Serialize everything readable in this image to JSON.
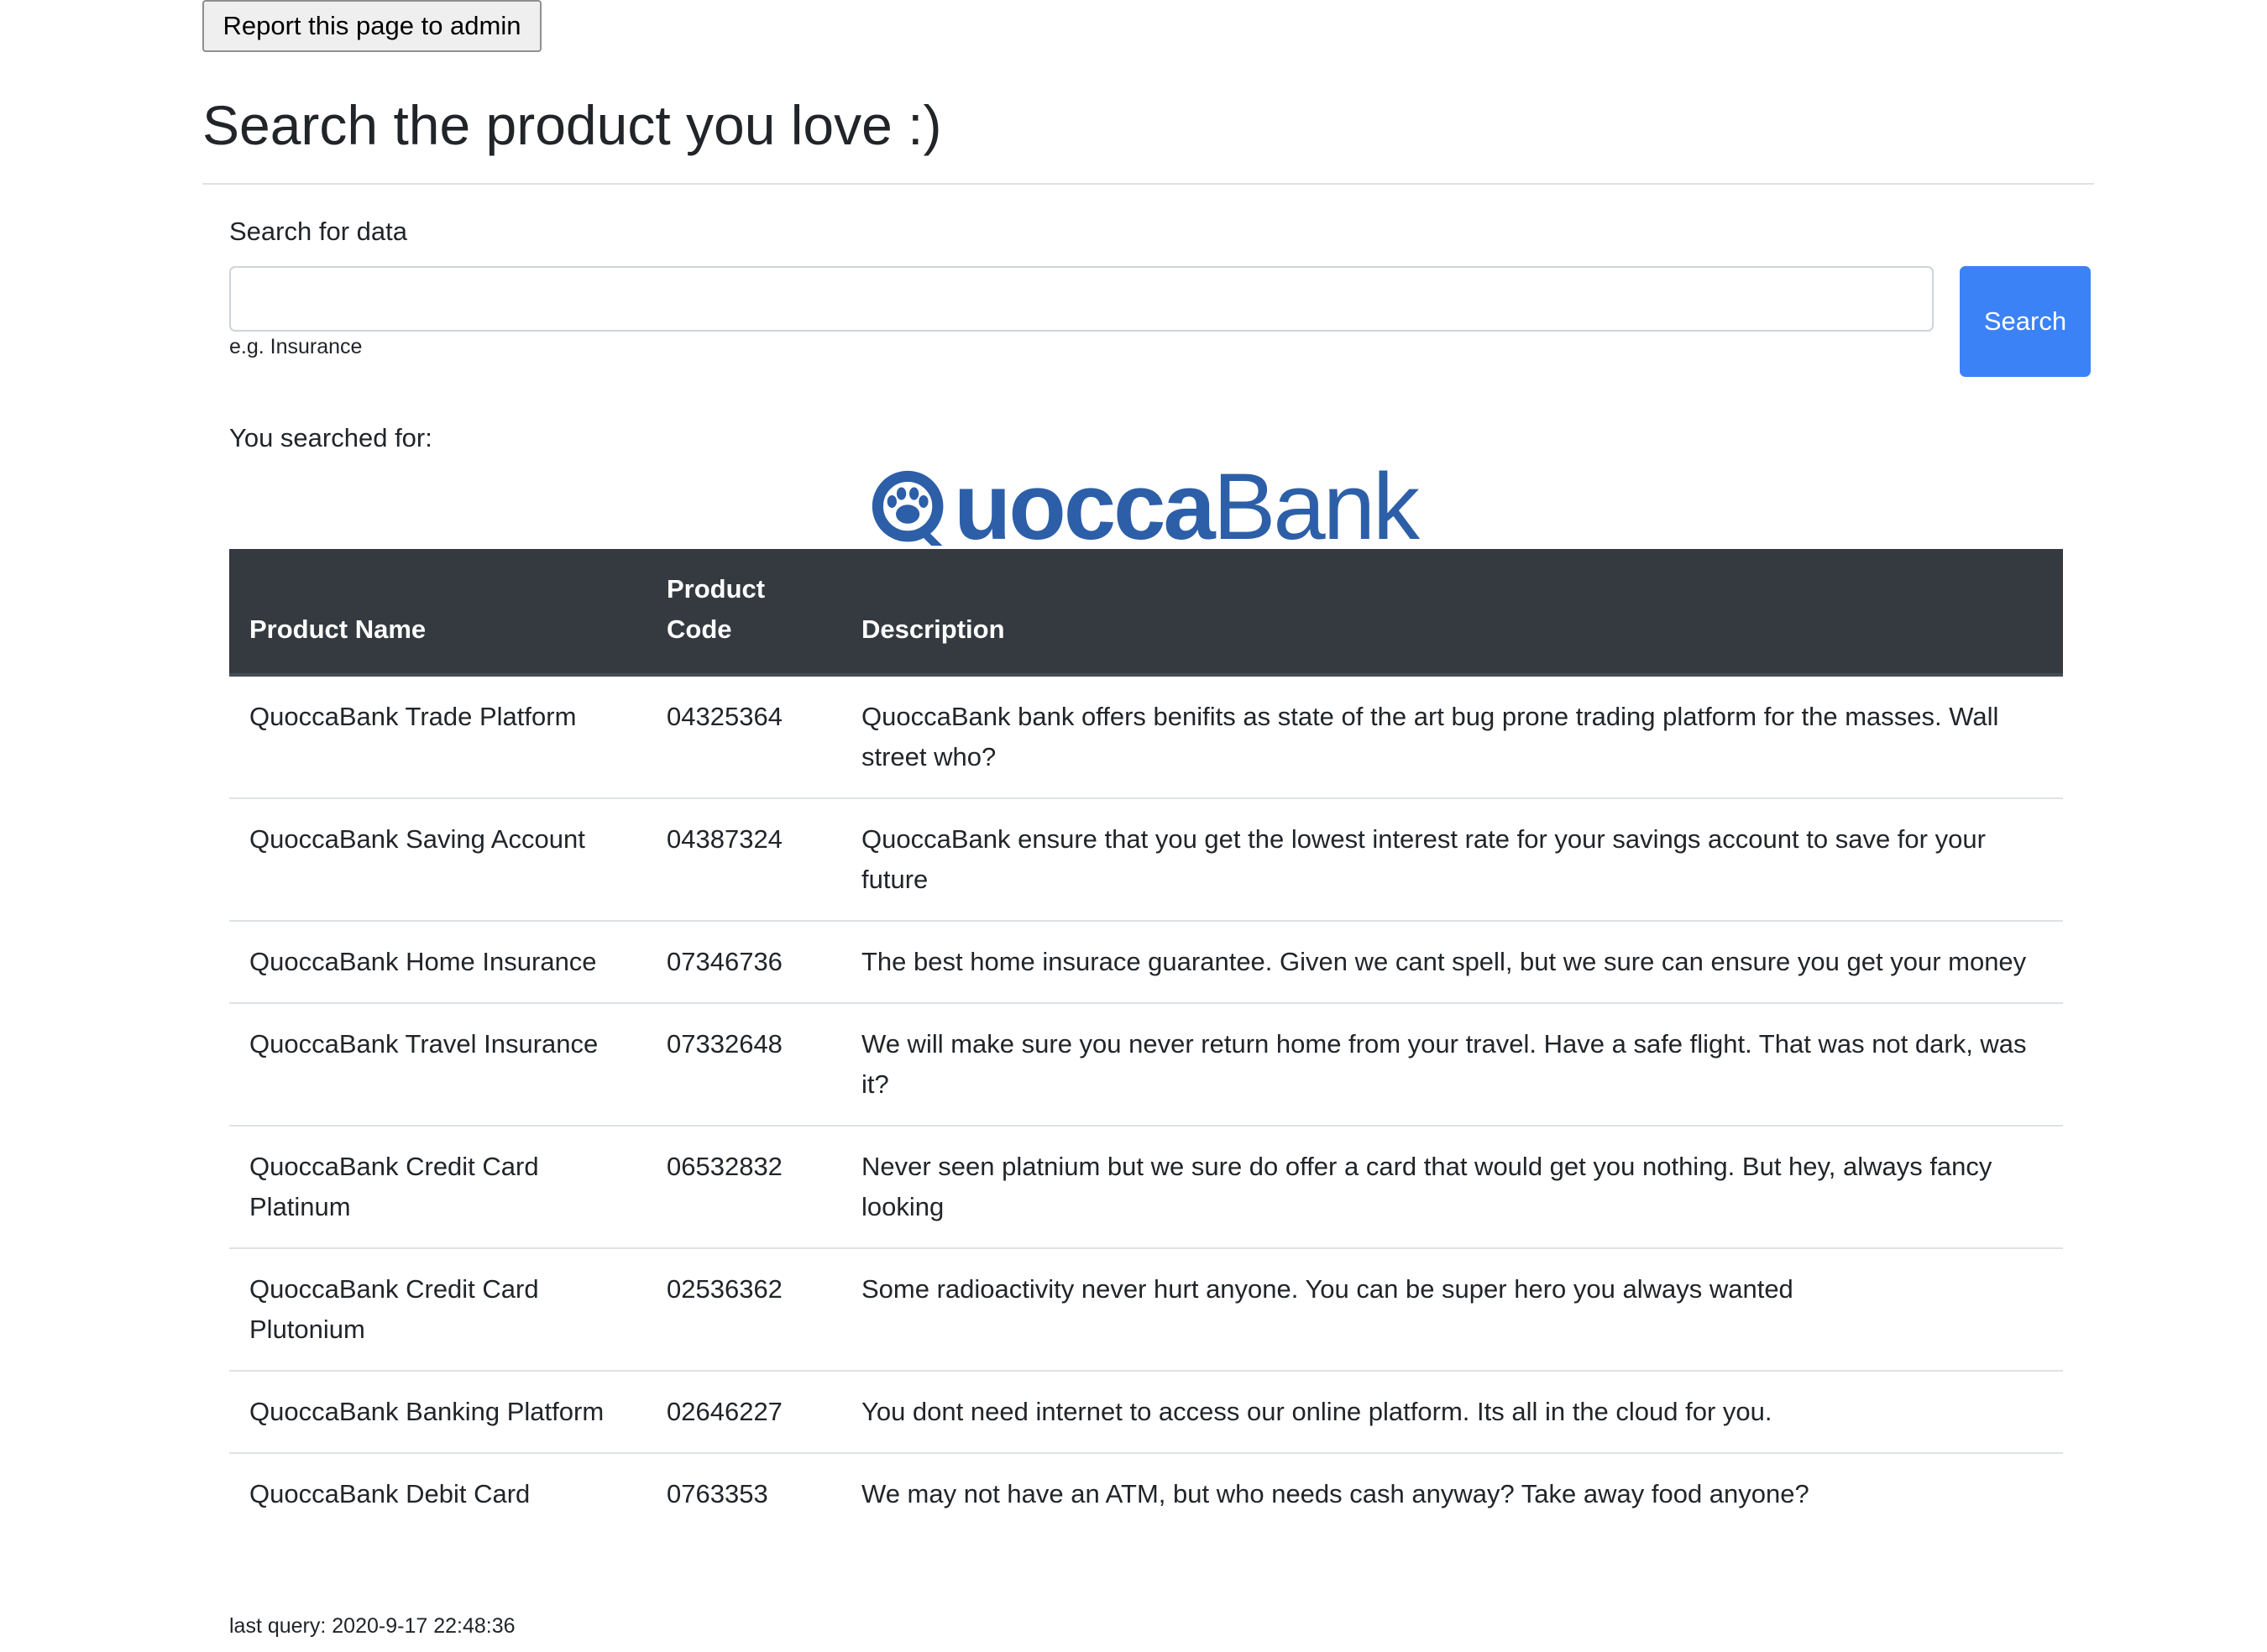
{
  "report_button": {
    "label": "Report this page to admin"
  },
  "heading": "Search the product you love :)",
  "search": {
    "label": "Search for data",
    "value": "",
    "placeholder": "",
    "help_text": "e.g. Insurance",
    "button_label": "Search"
  },
  "searched_for": "You searched for:",
  "logo": {
    "text_bold": "uocca",
    "text_light": "Bank",
    "full_text": "QuoccaBank",
    "icon": "paw-icon",
    "color": "#2d5fa8"
  },
  "table": {
    "headers": {
      "name": "Product Name",
      "code_line1": "Product",
      "code_line2": "Code",
      "description": "Description"
    },
    "rows": [
      {
        "name": "QuoccaBank Trade Platform",
        "code": "04325364",
        "description": "QuoccaBank bank offers benifits as state of the art bug prone trading platform for the masses. Wall street who?"
      },
      {
        "name": "QuoccaBank Saving Account",
        "code": "04387324",
        "description": "QuoccaBank ensure that you get the lowest interest rate for your savings account to save for your future"
      },
      {
        "name": "QuoccaBank Home Insurance",
        "code": "07346736",
        "description": "The best home insurace guarantee. Given we cant spell, but we sure can ensure you get your money"
      },
      {
        "name": "QuoccaBank Travel Insurance",
        "code": "07332648",
        "description": "We will make sure you never return home from your travel. Have a safe flight. That was not dark, was it?"
      },
      {
        "name": "QuoccaBank Credit Card Platinum",
        "code": "06532832",
        "description": "Never seen platnium but we sure do offer a card that would get you nothing. But hey, always fancy looking"
      },
      {
        "name": "QuoccaBank Credit Card Plutonium",
        "code": "02536362",
        "description": "Some radioactivity never hurt anyone. You can be super hero you always wanted"
      },
      {
        "name": "QuoccaBank Banking Platform",
        "code": "02646227",
        "description": "You dont need internet to access our online platform. Its all in the cloud for you."
      },
      {
        "name": "QuoccaBank Debit Card",
        "code": "0763353",
        "description": "We may not have an ATM, but who needs cash anyway? Take away food anyone?"
      }
    ]
  },
  "footer": {
    "last_query": "last query: 2020-9-17 22:48:36"
  },
  "colors": {
    "primary_button": "#3b82f6",
    "table_header": "#343a40",
    "brand_blue": "#2d5fa8"
  }
}
